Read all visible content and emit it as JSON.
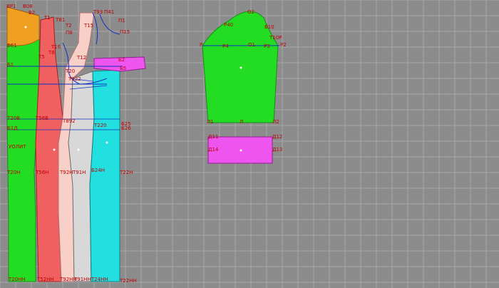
{
  "colors": {
    "background": "#8c8c8c",
    "grid": "#a8a8a8",
    "green": "#22dd22",
    "orange": "#f0a020",
    "red": "#f06060",
    "pink": "#f8d0c8",
    "cyan": "#22e0e0",
    "magenta": "#ee55ee",
    "label": "#c00000",
    "construction": "#1030c0"
  },
  "back_block": {
    "labels": {
      "top_a": "ВР1",
      "top_b": "В08",
      "top_c": "В2",
      "top_d": "Т1",
      "top_e": "Т81",
      "top_f": "Т2",
      "top_g": "Т93",
      "top_h": "П41",
      "right_top": "П1",
      "right_t15": "П15",
      "b61": "Б61",
      "t5": "Т5",
      "t16": "Т16",
      "t8": "Т8",
      "p8": "П8",
      "t15": "Т15",
      "t12": "Т12",
      "t922": "Т922",
      "b1": "Б1",
      "b2": "Б2",
      "b5": "Б5",
      "t20": "Т20",
      "t20b": "Т20В",
      "t56": "Т56В",
      "t892": "Т892",
      "b1d": "Б1Д",
      "t220": "Т220",
      "b25": "Б25",
      "b26": "Б26",
      "ynt": "УОЛИТ",
      "t20h": "Т20Н",
      "t56h": "Т56Н",
      "t92h": "Т92Н",
      "t91h": "Т91Н",
      "b24h": "Б24Н",
      "t22h": "Т22Н",
      "bot1": "Т20НН",
      "bot2": "Т52НН",
      "bot3": "Т92НН",
      "bot4": "Т91НН",
      "bot5": "Т24НН",
      "bot6": "Т22НН"
    }
  },
  "sleeve": {
    "labels": {
      "top": "О2",
      "left_upper": "Р40",
      "right_upper": "В10",
      "right_mid": "Т10Р",
      "left_mid": "Р",
      "p4": "Р4",
      "o1": "О1",
      "p3": "Р3",
      "right_mid2": "Р2",
      "bottom_left": "Л1",
      "bottom_mid": "Л",
      "bottom_right": "Л2"
    }
  },
  "cuff": {
    "labels": {
      "tl": "Д11",
      "tr": "Д12",
      "bl": "Д14",
      "br": "Д13"
    }
  }
}
